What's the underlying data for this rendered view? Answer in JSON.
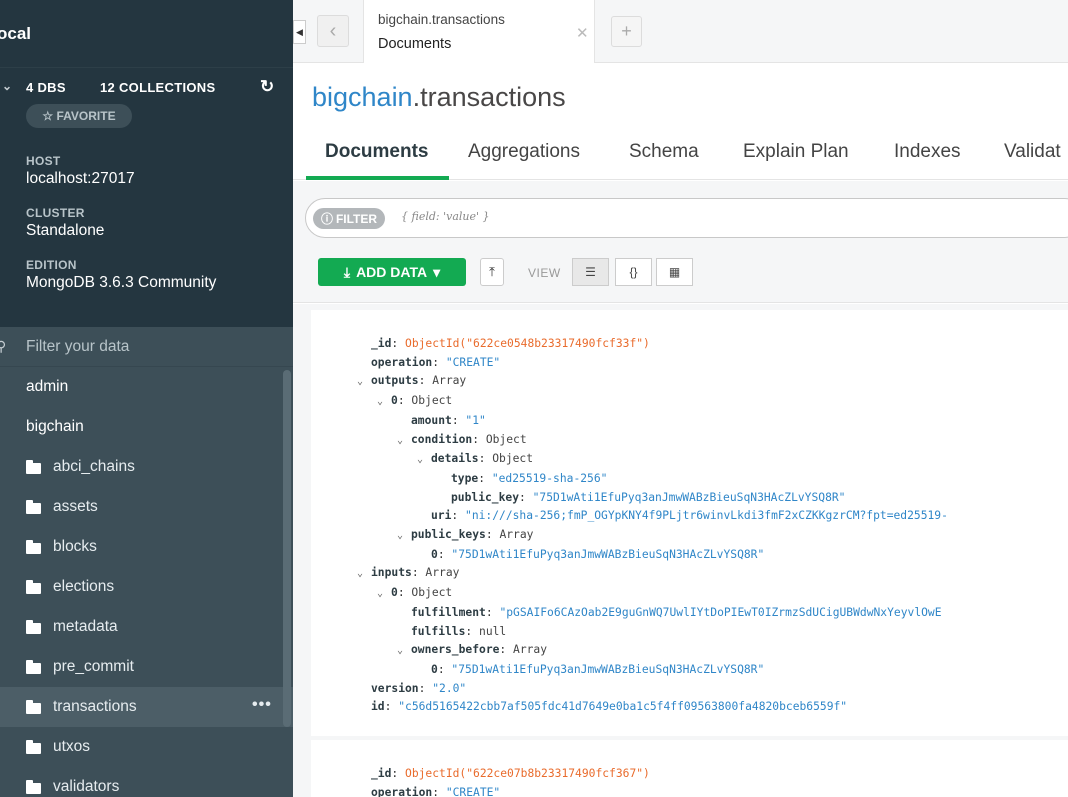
{
  "sidebar": {
    "title": "ocal",
    "stats": {
      "dbs": "4 DBS",
      "collections": "12 COLLECTIONS"
    },
    "favorite_label": "☆ FAVORITE",
    "info": [
      {
        "label": "HOST",
        "value": "localhost:27017"
      },
      {
        "label": "CLUSTER",
        "value": "Standalone"
      },
      {
        "label": "EDITION",
        "value": "MongoDB 3.6.3 Community"
      }
    ],
    "filter_placeholder": "Filter your data",
    "databases": [
      "admin",
      "bigchain"
    ],
    "collections": [
      "abci_chains",
      "assets",
      "blocks",
      "elections",
      "metadata",
      "pre_commit",
      "transactions",
      "utxos",
      "validators"
    ],
    "active_collection": "transactions"
  },
  "tabbar": {
    "tab_namespace": "bigchain.transactions",
    "tab_subtitle": "Documents"
  },
  "namespace": {
    "db": "bigchain",
    "collection": ".transactions"
  },
  "subtabs": [
    "Documents",
    "Aggregations",
    "Schema",
    "Explain Plan",
    "Indexes",
    "Validat"
  ],
  "query": {
    "filter_label": "FILTER",
    "filter_placeholder": "{ field: 'value' }",
    "add_data_label": "ADD DATA",
    "view_label": "VIEW"
  },
  "documents": [
    {
      "id": "ObjectId(\"622ce0548b23317490fcf33f\")",
      "operation": "\"CREATE\"",
      "amount": "\"1\"",
      "type": "\"ed25519-sha-256\"",
      "public_key": "\"75D1wAti1EfuPyq3anJmwWABzBieuSqN3HAcZLvYSQ8R\"",
      "uri": "\"ni:///sha-256;fmP_OGYpKNY4f9PLjtr6winvLkdi3fmF2xCZKKgzrCM?fpt=ed25519-",
      "public_keys_0": "\"75D1wAti1EfuPyq3anJmwWABzBieuSqN3HAcZLvYSQ8R\"",
      "fulfillment": "\"pGSAIFo6CAzOab2E9guGnWQ7UwlIYtDoPIEwT0IZrmzSdUCigUBWdwNxYeyvlOwE",
      "fulfills": "null",
      "owners_before_0": "\"75D1wAti1EfuPyq3anJmwWABzBieuSqN3HAcZLvYSQ8R\"",
      "version": "\"2.0\"",
      "txid": "\"c56d5165422cbb7af505fdc41d7649e0ba1c5f4ff09563800fa4820bceb6559f\""
    },
    {
      "id": "ObjectId(\"622ce07b8b23317490fcf367\")",
      "operation": "\"CREATE\""
    }
  ],
  "colors": {
    "sidebar_bg": "#3d4f58",
    "sidebar_dark": "#243640",
    "accent_green": "#13aa52",
    "link_blue": "#2f86c8",
    "objectid_orange": "#e96b2c"
  }
}
